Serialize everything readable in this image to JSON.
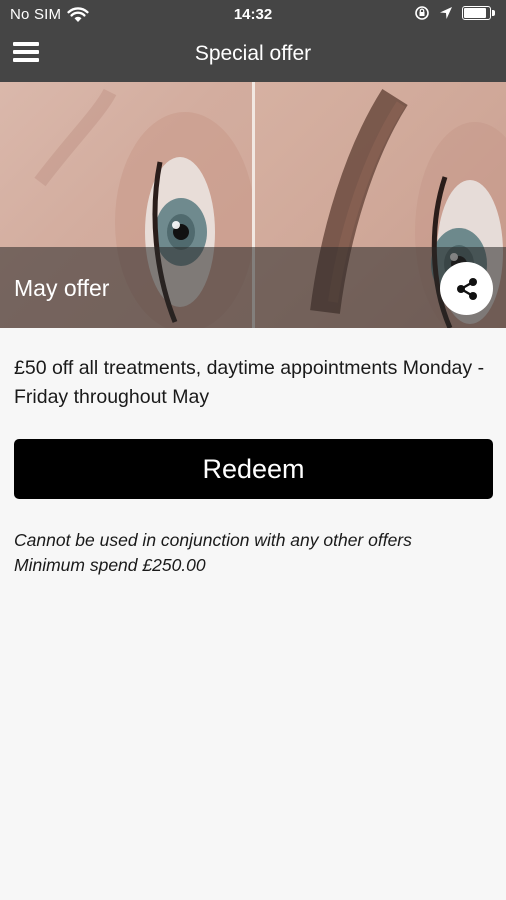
{
  "status_bar": {
    "carrier": "No SIM",
    "time": "14:32",
    "icons": [
      "wifi-icon",
      "rotation-lock-icon",
      "location-icon",
      "battery-icon"
    ]
  },
  "nav": {
    "title": "Special offer",
    "menu_icon": "hamburger-menu-icon"
  },
  "hero": {
    "caption": "May offer",
    "share_icon": "share-icon"
  },
  "offer": {
    "description": "£50 off all treatments, daytime appointments Monday - Friday throughout May",
    "redeem_label": "Redeem",
    "terms_line1": "Cannot be used in conjunction with any other offers",
    "terms_line2": "Minimum spend £250.00"
  },
  "colors": {
    "bar_background": "#454545",
    "page_background": "#f7f7f7",
    "button_background": "#000000",
    "button_text": "#ffffff"
  }
}
